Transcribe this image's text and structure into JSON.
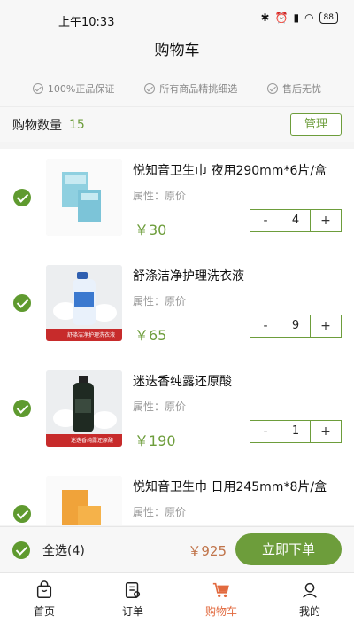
{
  "status": {
    "time": "上午10:33",
    "battery": "88"
  },
  "header": {
    "title": "购物车"
  },
  "guarantees": [
    "100%正品保证",
    "所有商品精挑细选",
    "售后无忧"
  ],
  "cart": {
    "count_label": "购物数量",
    "count": "15",
    "manage_label": "管理"
  },
  "items": [
    {
      "name": "悦知音卫生巾 夜用290mm*6片/盒",
      "attr": "属性：原价",
      "price": "￥30",
      "qty": "4"
    },
    {
      "name": "舒涤洁净护理洗衣液",
      "attr": "属性：原价",
      "price": "￥65",
      "qty": "9"
    },
    {
      "name": "迷迭香纯露还原酸",
      "attr": "属性：原价",
      "price": "￥190",
      "qty": "1"
    },
    {
      "name": "悦知音卫生巾 日用245mm*8片/盒",
      "attr": "属性：原价",
      "price": "",
      "qty": ""
    }
  ],
  "thumb_captions": [
    "舒涤洁净护理洗衣液",
    "迷迭香纯露还原酸"
  ],
  "stepper": {
    "minus": "-",
    "plus": "+"
  },
  "footer": {
    "select_all": "全选(4)",
    "total": "￥925",
    "order_label": "立即下单"
  },
  "tabs": [
    {
      "label": "首页",
      "icon": "bag-icon"
    },
    {
      "label": "订单",
      "icon": "order-icon"
    },
    {
      "label": "购物车",
      "icon": "cart-icon"
    },
    {
      "label": "我的",
      "icon": "user-icon"
    }
  ],
  "colors": {
    "accent": "#6d9d3b",
    "price": "#c0744a",
    "active_tab": "#e26a3f"
  }
}
